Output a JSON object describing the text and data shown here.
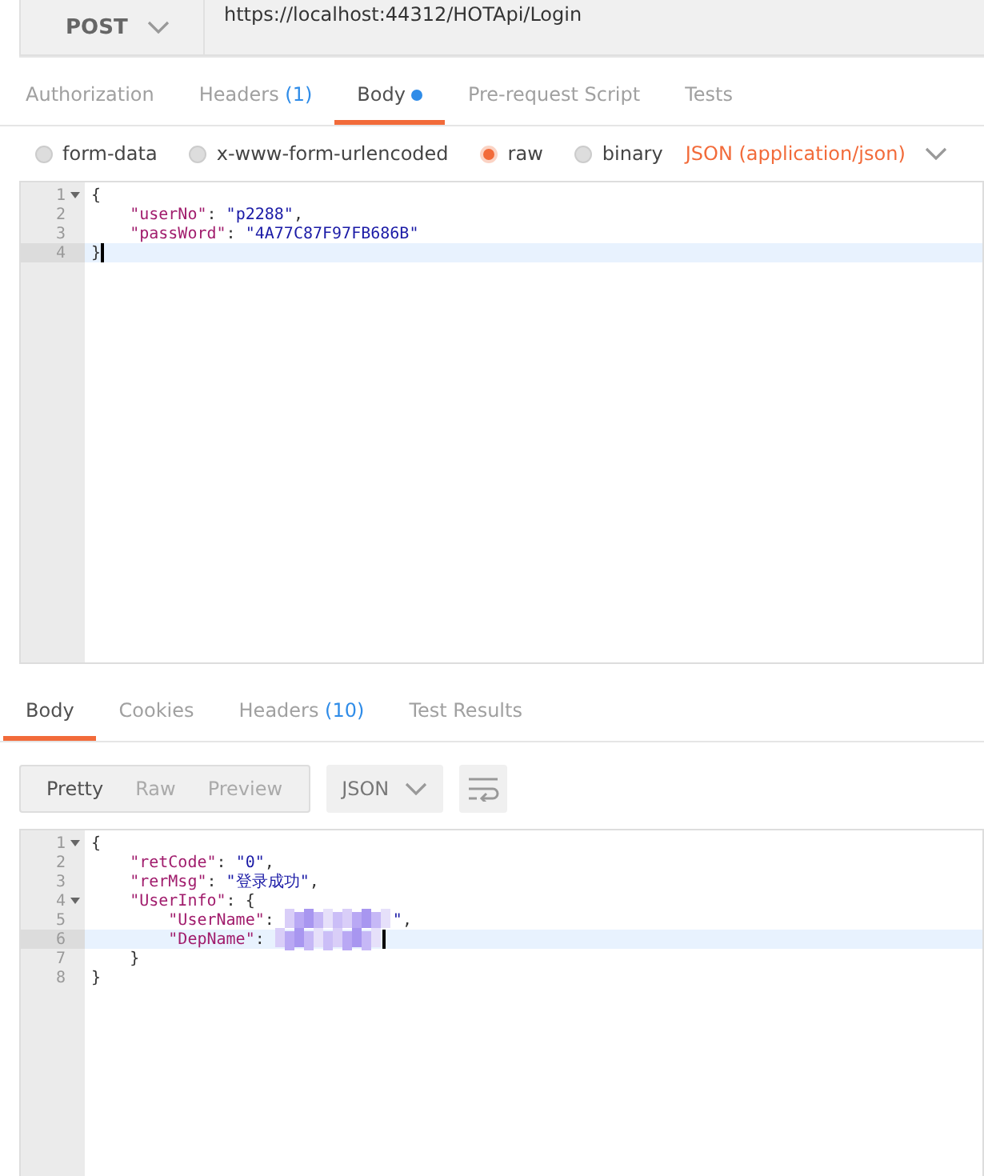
{
  "request": {
    "method": "POST",
    "url": "https://localhost:44312/HOTApi/Login"
  },
  "request_tabs": [
    {
      "label": "Authorization",
      "selected": false
    },
    {
      "label": "Headers",
      "count": "(1)",
      "selected": false
    },
    {
      "label": "Body",
      "dot": true,
      "selected": true
    },
    {
      "label": "Pre-request Script",
      "selected": false
    },
    {
      "label": "Tests",
      "selected": false
    }
  ],
  "body_types": [
    {
      "label": "form-data",
      "selected": false
    },
    {
      "label": "x-www-form-urlencoded",
      "selected": false
    },
    {
      "label": "raw",
      "selected": true
    },
    {
      "label": "binary",
      "selected": false
    }
  ],
  "content_type": "JSON (application/json)",
  "request_body": [
    {
      "number": "1",
      "fold": true,
      "active": false,
      "tokens": [
        {
          "kind": "punct",
          "text": "{"
        }
      ]
    },
    {
      "number": "2",
      "fold": false,
      "active": false,
      "tokens": [
        {
          "kind": "key",
          "text": "\"userNo\""
        },
        {
          "kind": "punct",
          "text": ": "
        },
        {
          "kind": "string",
          "text": "\"p2288\""
        },
        {
          "kind": "punct",
          "text": ","
        }
      ]
    },
    {
      "number": "3",
      "fold": false,
      "active": false,
      "tokens": [
        {
          "kind": "key",
          "text": "\"passWord\""
        },
        {
          "kind": "punct",
          "text": ": "
        },
        {
          "kind": "string",
          "text": "\"4A77C87F97FB686B\""
        }
      ]
    },
    {
      "number": "4",
      "fold": false,
      "active": true,
      "tokens": [
        {
          "kind": "punct",
          "text": "}"
        }
      ]
    }
  ],
  "response_tabs": [
    {
      "label": "Body",
      "selected": true
    },
    {
      "label": "Cookies",
      "selected": false
    },
    {
      "label": "Headers",
      "count": "(10)",
      "selected": false
    },
    {
      "label": "Test Results",
      "selected": false
    }
  ],
  "view_modes": [
    {
      "label": "Pretty",
      "selected": true
    },
    {
      "label": "Raw",
      "selected": false
    },
    {
      "label": "Preview",
      "selected": false
    }
  ],
  "format": "JSON",
  "response_body": [
    {
      "number": "1",
      "fold": true,
      "active": false,
      "tokens": [
        {
          "kind": "punct",
          "text": "{"
        }
      ]
    },
    {
      "number": "2",
      "fold": false,
      "active": false,
      "tokens": [
        {
          "kind": "key",
          "text": "\"retCode\""
        },
        {
          "kind": "punct",
          "text": ": "
        },
        {
          "kind": "string",
          "text": "\"0\""
        },
        {
          "kind": "punct",
          "text": ","
        }
      ]
    },
    {
      "number": "3",
      "fold": false,
      "active": false,
      "tokens": [
        {
          "kind": "key",
          "text": "\"rerMsg\""
        },
        {
          "kind": "punct",
          "text": ": "
        },
        {
          "kind": "string",
          "text": "\"登录成功\""
        },
        {
          "kind": "punct",
          "text": ","
        }
      ]
    },
    {
      "number": "4",
      "fold": true,
      "active": false,
      "tokens": [
        {
          "kind": "key",
          "text": "\"UserInfo\""
        },
        {
          "kind": "punct",
          "text": ": {"
        }
      ]
    },
    {
      "number": "5",
      "fold": false,
      "active": false,
      "tokens": [
        {
          "kind": "key",
          "text": "\"UserName\""
        },
        {
          "kind": "punct",
          "text": ": "
        },
        {
          "kind": "redacted"
        },
        {
          "kind": "string",
          "text": "\""
        },
        {
          "kind": "punct",
          "text": ","
        }
      ]
    },
    {
      "number": "6",
      "fold": false,
      "active": true,
      "tokens": [
        {
          "kind": "key",
          "text": "\"DepName\""
        },
        {
          "kind": "punct",
          "text": ": "
        },
        {
          "kind": "redacted"
        }
      ]
    },
    {
      "number": "7",
      "fold": false,
      "active": false,
      "tokens": [
        {
          "kind": "punct",
          "text": "}"
        }
      ]
    },
    {
      "number": "8",
      "fold": false,
      "active": false,
      "tokens": [
        {
          "kind": "punct",
          "text": "}"
        }
      ]
    }
  ]
}
